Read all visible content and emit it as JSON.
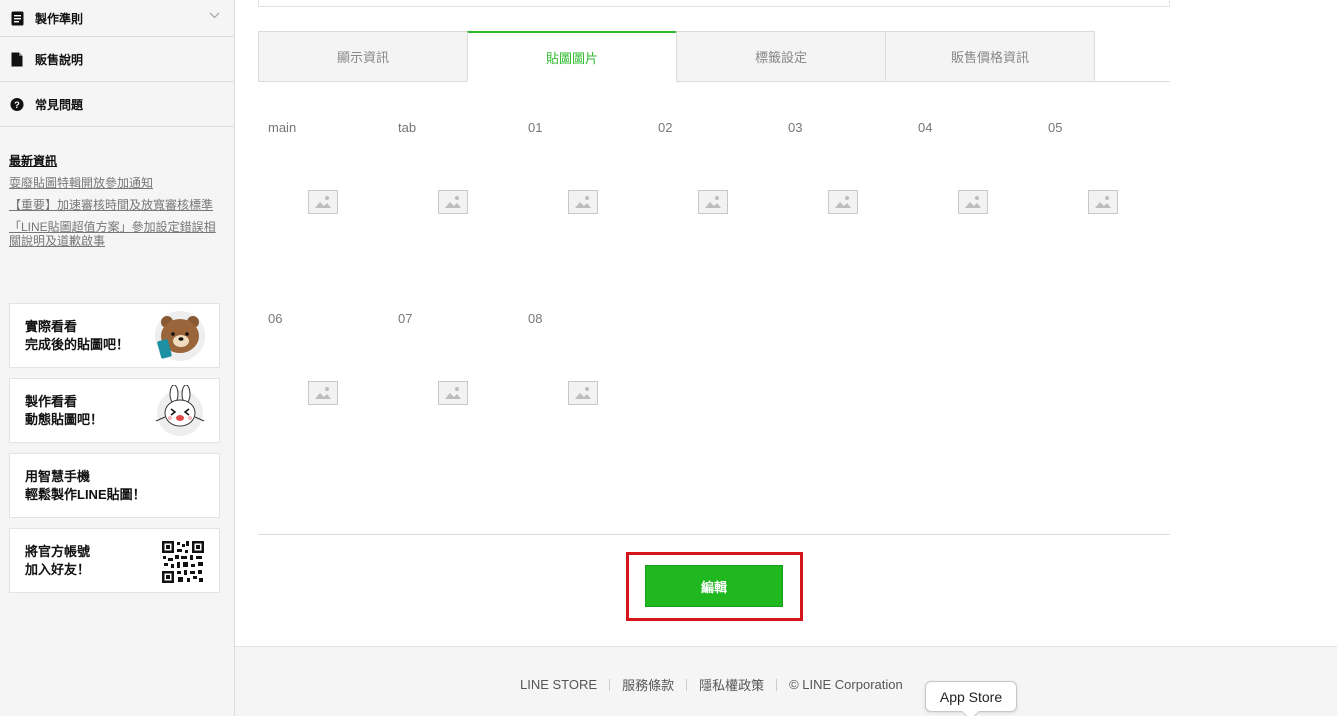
{
  "sidebar": {
    "menu": [
      {
        "label": "製作準則",
        "icon": "document-icon"
      },
      {
        "label": "販售說明",
        "icon": "file-icon"
      },
      {
        "label": "常見問題",
        "icon": "question-icon"
      }
    ],
    "news": {
      "title": "最新資訊",
      "links": [
        "耍廢貼圖特輯開放參加通知",
        "【重要】加速審核時間及放寬審核標準",
        "「LINE貼圖超值方案」參加設定錯誤相關說明及道歉啟事"
      ]
    },
    "promos": [
      {
        "line1": "實際看看",
        "line2": "完成後的貼圖吧！",
        "art": "brown-bear-icon"
      },
      {
        "line1": "製作看看",
        "line2": "動態貼圖吧！",
        "art": "cony-rabbit-icon"
      },
      {
        "line1": "用智慧手機",
        "line2": "輕鬆製作LINE貼圖！",
        "art": ""
      },
      {
        "line1": "將官方帳號",
        "line2": "加入好友！",
        "art": "qr-code-icon"
      }
    ]
  },
  "tabs": [
    {
      "label": "顯示資訊",
      "active": false
    },
    {
      "label": "貼圖圖片",
      "active": true
    },
    {
      "label": "標籤設定",
      "active": false
    },
    {
      "label": "販售價格資訊",
      "active": false
    }
  ],
  "stickers_row1": [
    "main",
    "tab",
    "01",
    "02",
    "03",
    "04",
    "05"
  ],
  "stickers_row2": [
    "06",
    "07",
    "08"
  ],
  "edit_button": "編輯",
  "footer": {
    "links": [
      "LINE STORE",
      "服務條款",
      "隱私權政策"
    ],
    "copyright": "© LINE Corporation",
    "tooltip": "App Store"
  },
  "colors": {
    "accent_green": "#1fb81f",
    "highlight_red": "#d6141b"
  }
}
